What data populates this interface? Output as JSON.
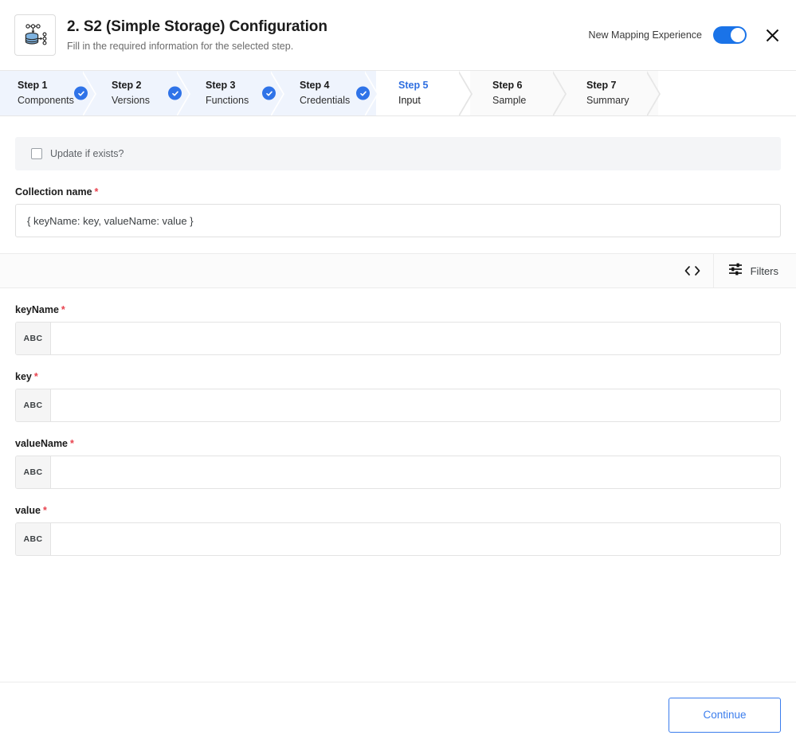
{
  "header": {
    "title": "2. S2 (Simple Storage) Configuration",
    "subtitle": "Fill in the required information for the selected step.",
    "icon": "database-storage-icon",
    "toggle_label": "New Mapping Experience",
    "toggle_on": true,
    "close_icon": "close-icon",
    "accent_color": "#1a73e8"
  },
  "stepper": {
    "steps": [
      {
        "num": "Step 1",
        "name": "Components",
        "state": "done"
      },
      {
        "num": "Step 2",
        "name": "Versions",
        "state": "done"
      },
      {
        "num": "Step 3",
        "name": "Functions",
        "state": "done"
      },
      {
        "num": "Step 4",
        "name": "Credentials",
        "state": "done"
      },
      {
        "num": "Step 5",
        "name": "Input",
        "state": "active"
      },
      {
        "num": "Step 6",
        "name": "Sample",
        "state": "todo"
      },
      {
        "num": "Step 7",
        "name": "Summary",
        "state": "todo"
      }
    ],
    "check_icon": "check-circle-icon",
    "active_color": "#2f6fe0"
  },
  "form": {
    "update_checkbox_label": "Update if exists?",
    "update_checked": false,
    "collection_name_label": "Collection name",
    "collection_name_required": "*",
    "collection_name_value": "{ keyName: key, valueName: value }",
    "fields": [
      {
        "label": "keyName",
        "required": "*",
        "type_chip": "ABC",
        "value": ""
      },
      {
        "label": "key",
        "required": "*",
        "type_chip": "ABC",
        "value": ""
      },
      {
        "label": "valueName",
        "required": "*",
        "type_chip": "ABC",
        "value": ""
      },
      {
        "label": "value",
        "required": "*",
        "type_chip": "ABC",
        "value": ""
      }
    ]
  },
  "toolbar": {
    "code_icon": "code-brackets-icon",
    "filters_icon": "filter-sliders-icon",
    "filters_label": "Filters"
  },
  "footer": {
    "continue_label": "Continue",
    "continue_color": "#3b7ded"
  }
}
